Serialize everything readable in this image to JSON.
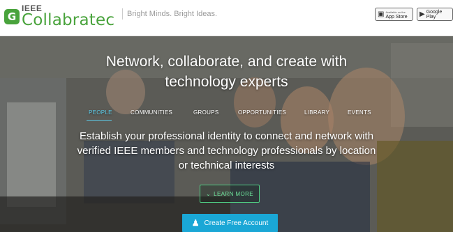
{
  "header": {
    "logo_small": "IEEE",
    "logo_word": "Collabratec",
    "logo_mark": "G",
    "tagline": "Bright Minds. Bright Ideas.",
    "app_store_small": "Available on the",
    "app_store_big": "App Store",
    "google_play_big": "Google Play"
  },
  "hero": {
    "headline_line1": "Network, collaborate, and create with",
    "headline_line2": "technology experts",
    "nav": [
      "PEOPLE",
      "COMMUNITIES",
      "GROUPS",
      "OPPORTUNITIES",
      "LIBRARY",
      "EVENTS"
    ],
    "active_tab": "PEOPLE",
    "description_line1": "Establish your professional identity to connect and network with",
    "description_line2": "verified IEEE members and technology professionals by location",
    "description_line3": "or technical interests",
    "learn_more": "LEARN MORE",
    "create_account": "Create Free Account"
  },
  "colors": {
    "brand_green": "#49a33c",
    "accent_blue": "#1aa7d6",
    "active_tab": "#5ccbe8",
    "learn_more_green": "#4fcf83"
  },
  "icons": [
    "apple-icon",
    "play-icon",
    "chevron-down-icon",
    "person-icon"
  ]
}
